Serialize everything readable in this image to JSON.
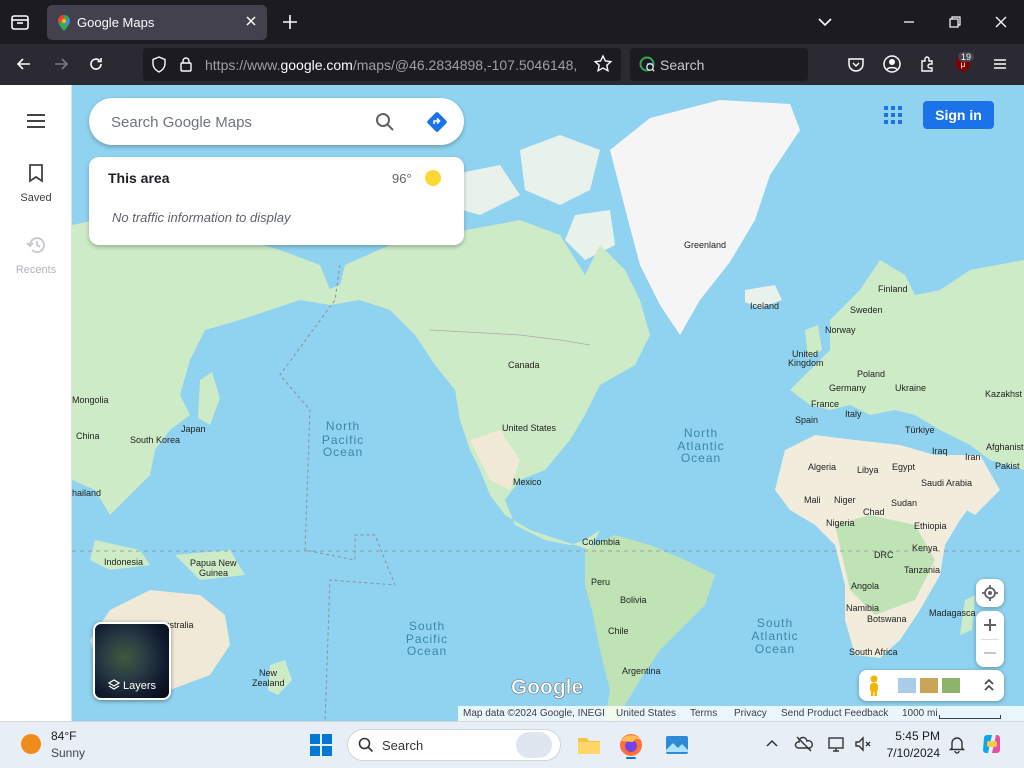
{
  "browser": {
    "tab_title": "Google Maps",
    "url_prefix": "https://www.",
    "url_host": "google.com",
    "url_rest": "/maps/@46.2834898,-107.5046148,",
    "search_placeholder": "Search",
    "extension_badge": "19"
  },
  "leftnav": {
    "items": [
      {
        "label": "Saved"
      },
      {
        "label": "Recents"
      }
    ]
  },
  "search": {
    "placeholder": "Search Google Maps"
  },
  "area_card": {
    "title": "This area",
    "temperature": "96°",
    "traffic_text": "No traffic information to display"
  },
  "header": {
    "signin_label": "Sign in"
  },
  "layers": {
    "label": "Layers"
  },
  "map_labels": {
    "greenland": "Greenland",
    "iceland": "Iceland",
    "finland": "Finland",
    "sweden": "Sweden",
    "norway": "Norway",
    "united_kingdom_1": "United",
    "united_kingdom_2": "Kingdom",
    "poland": "Poland",
    "germany": "Germany",
    "ukraine": "Ukraine",
    "france": "France",
    "kazakhstan": "Kazakhst",
    "spain": "Spain",
    "italy": "Italy",
    "turkiye": "Türkiye",
    "afghanistan": "Afghanist",
    "iraq": "Iraq",
    "iran": "Iran",
    "pakistan": "Pakist",
    "algeria": "Algeria",
    "libya": "Libya",
    "egypt": "Egypt",
    "saudi_arabia": "Saudi Arabia",
    "mali": "Mali",
    "niger": "Niger",
    "chad": "Chad",
    "sudan": "Sudan",
    "nigeria": "Nigeria",
    "ethiopia": "Ethiopia",
    "drc": "DRC",
    "kenya": "Kenya",
    "tanzania": "Tanzania",
    "angola": "Angola",
    "namibia": "Namibia",
    "botswana": "Botswana",
    "madagascar": "Madagasca",
    "south_africa": "South Africa",
    "canada": "Canada",
    "united_states": "United States",
    "mexico": "Mexico",
    "colombia": "Colombia",
    "peru": "Peru",
    "bolivia": "Bolivia",
    "chile": "Chile",
    "argentina": "Argentina",
    "mongolia": "Mongolia",
    "china": "China",
    "south_korea": "South Korea",
    "japan": "Japan",
    "thailand": "hailand",
    "indonesia": "Indonesia",
    "papua_1": "Papua New",
    "papua_2": "Guinea",
    "australia": "ıstralia",
    "new_zealand_1": "New",
    "new_zealand_2": "Zealand",
    "north_pacific": [
      "North",
      "Pacific",
      "Ocean"
    ],
    "south_pacific": [
      "South",
      "Pacific",
      "Ocean"
    ],
    "north_atlantic": [
      "North",
      "Atlantic",
      "Ocean"
    ],
    "south_atlantic": [
      "South",
      "Atlantic",
      "Ocean"
    ],
    "google_logo": "Google"
  },
  "attribution": {
    "map_data": "Map data ©2024 Google, INEGI",
    "country": "United States",
    "terms": "Terms",
    "privacy": "Privacy",
    "feedback": "Send Product Feedback",
    "scale": "1000 mi"
  },
  "taskbar": {
    "weather_temp": "84°F",
    "weather_desc": "Sunny",
    "search_label": "Search",
    "time": "5:45 PM",
    "date": "7/10/2024"
  },
  "colors": {
    "ocean": "#8fd3f0",
    "land": "#cdebc7",
    "ice": "#f5f5f5",
    "desert": "#f1ecdc",
    "accent": "#1a73e8"
  }
}
